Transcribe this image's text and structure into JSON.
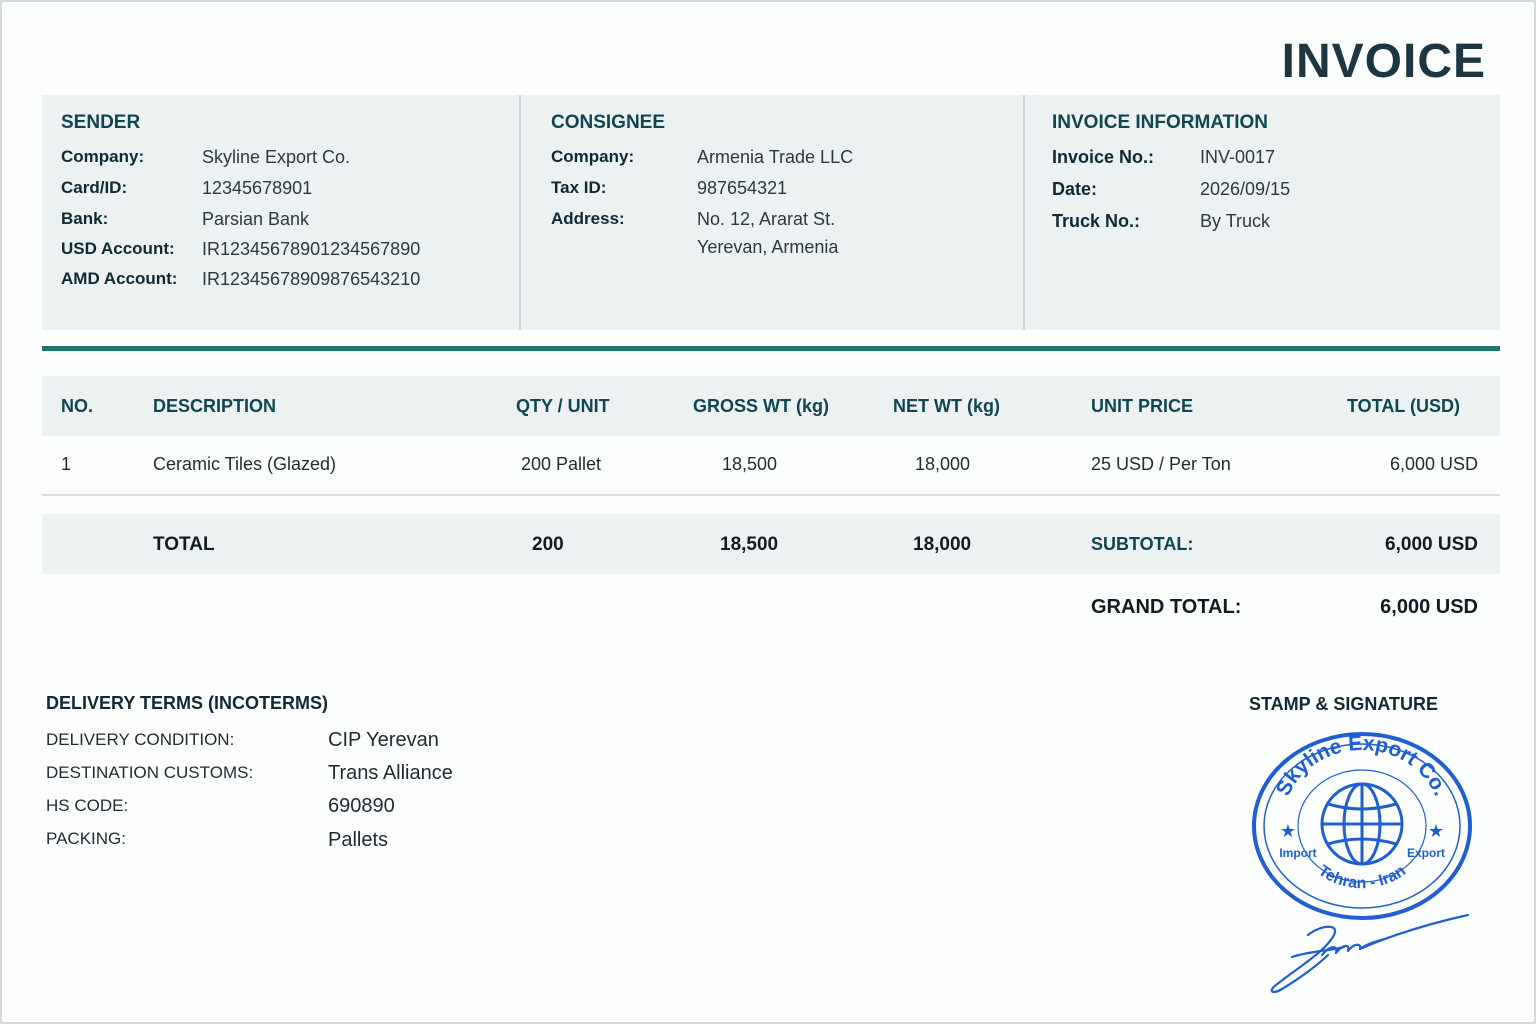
{
  "document": {
    "title": "INVOICE"
  },
  "sender": {
    "heading": "SENDER",
    "fields": [
      {
        "label": "Company:",
        "value": "Skyline Export Co."
      },
      {
        "label": "Card/ID:",
        "value": "12345678901"
      },
      {
        "label": "Bank:",
        "value": "Parsian Bank"
      },
      {
        "label": "USD Account:",
        "value": "IR12345678901234567890"
      },
      {
        "label": "AMD Account:",
        "value": "IR12345678909876543210"
      }
    ]
  },
  "consignee": {
    "heading": "CONSIGNEE",
    "fields": [
      {
        "label": "Company:",
        "value": "Armenia Trade LLC"
      },
      {
        "label": "Tax ID:",
        "value": "987654321"
      },
      {
        "label": "Address:",
        "value": "No. 12, Ararat St.",
        "value2": "Yerevan, Armenia"
      }
    ]
  },
  "invoice_info": {
    "heading": "INVOICE INFORMATION",
    "fields": [
      {
        "label": "Invoice No.:",
        "value": "INV-0017"
      },
      {
        "label": "Date:",
        "value": "2026/09/15"
      },
      {
        "label": "Truck No.:",
        "value": "By Truck"
      }
    ]
  },
  "table": {
    "headers": [
      "NO.",
      "DESCRIPTION",
      "QTY / UNIT",
      "GROSS WT (kg)",
      "NET WT (kg)",
      "UNIT PRICE",
      "TOTAL (USD)"
    ],
    "rows": [
      [
        "1",
        "Ceramic Tiles (Glazed)",
        "200 Pallet",
        "18,500",
        "18,000",
        "25 USD / Per Ton",
        "6,000 USD"
      ]
    ],
    "totals": {
      "label": "TOTAL",
      "qty": "200",
      "gross": "18,500",
      "net": "18,000",
      "subtotal_label": "SUBTOTAL:",
      "subtotal_value": "6,000 USD"
    },
    "grand_total": {
      "label": "GRAND TOTAL:",
      "value": "6,000 USD"
    }
  },
  "delivery_terms": {
    "heading": "DELIVERY TERMS (INCOTERMS)",
    "items": [
      {
        "label": "DELIVERY CONDITION:",
        "value": "CIP Yerevan"
      },
      {
        "label": "DESTINATION CUSTOMS:",
        "value": "Trans Alliance"
      },
      {
        "label": "HS CODE:",
        "value": "690890"
      },
      {
        "label": "PACKING:",
        "value": "Pallets"
      }
    ]
  },
  "stamp": {
    "heading": "STAMP & SIGNATURE",
    "top_text": "Skyline Export Co.",
    "left_text": "Import",
    "right_text": "Export",
    "bottom_text": "Tehran - Iran",
    "color": "#1f5fd1"
  },
  "colors": {
    "accent": "#1d7570",
    "panel": "#ecf1f2",
    "heading": "#0f4650"
  }
}
